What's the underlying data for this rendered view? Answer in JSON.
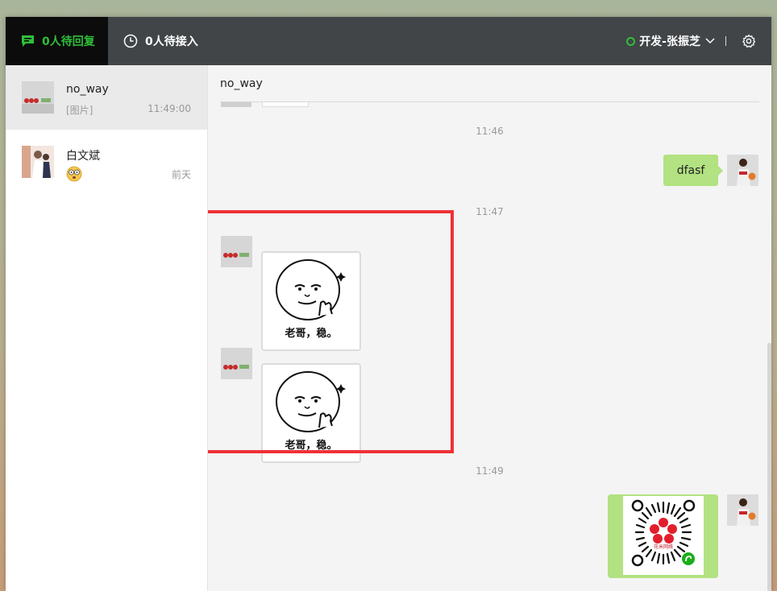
{
  "topbar": {
    "tab_reply_label": "0人待回复",
    "tab_waiting_label": "0人待接入",
    "user_name": "开发-张振芝",
    "accent_color": "#2fbf3a"
  },
  "sidebar": {
    "conversations": [
      {
        "name": "no_way",
        "preview": "[图片]",
        "time": "11:49:00",
        "active": true
      },
      {
        "name": "白文斌",
        "preview_icon": "dizzy-face-emoji",
        "time": "前天",
        "active": false
      }
    ]
  },
  "chat": {
    "title": "no_way",
    "timestamps": [
      "11:46",
      "11:47",
      "11:49"
    ],
    "messages": [
      {
        "from": "agent",
        "type": "text",
        "text": "dfasf"
      },
      {
        "from": "customer",
        "type": "sticker",
        "caption": "老哥，稳。"
      },
      {
        "from": "customer",
        "type": "sticker",
        "caption": "老哥，稳。"
      },
      {
        "from": "agent",
        "type": "image",
        "image_label": "花米网络"
      }
    ]
  }
}
